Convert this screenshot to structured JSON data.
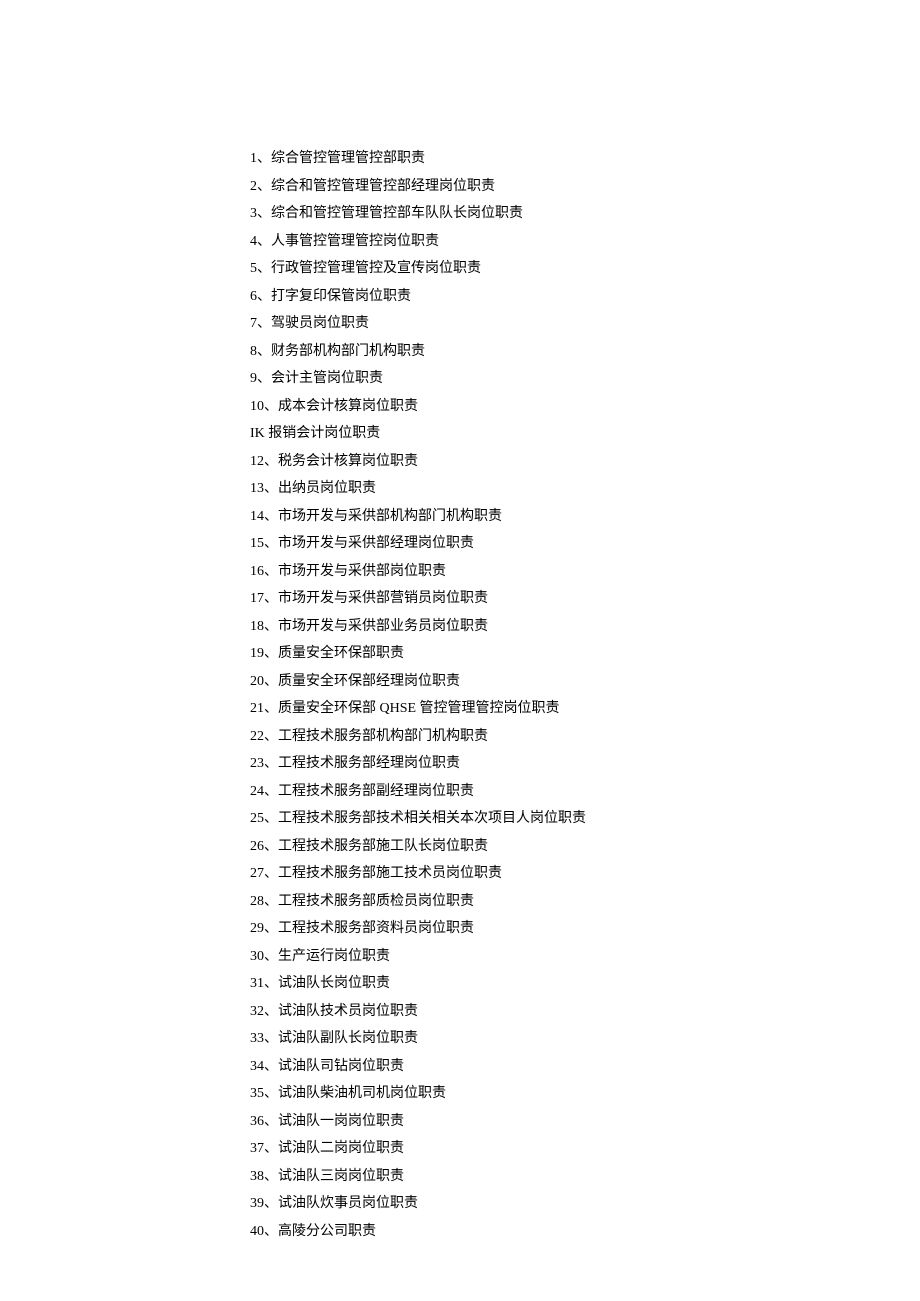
{
  "items": [
    "1、综合管控管理管控部职责",
    "2、综合和管控管理管控部经理岗位职责",
    "3、综合和管控管理管控部车队队长岗位职责",
    "4、人事管控管理管控岗位职责",
    "5、行政管控管理管控及宣传岗位职责",
    "6、打字复印保管岗位职责",
    "7、驾驶员岗位职责",
    "8、财务部机构部门机构职责",
    "9、会计主管岗位职责",
    "10、成本会计核算岗位职责",
    "IK 报销会计岗位职责",
    "12、税务会计核算岗位职责",
    "13、出纳员岗位职责",
    "14、市场开发与采供部机构部门机构职责",
    "15、市场开发与采供部经理岗位职责",
    "16、市场开发与采供部岗位职责",
    "17、市场开发与采供部营销员岗位职责",
    "18、市场开发与采供部业务员岗位职责",
    "19、质量安全环保部职责",
    "20、质量安全环保部经理岗位职责",
    "21、质量安全环保部 QHSE 管控管理管控岗位职责",
    "22、工程技术服务部机构部门机构职责",
    "23、工程技术服务部经理岗位职责",
    "24、工程技术服务部副经理岗位职责",
    "25、工程技术服务部技术相关相关本次项目人岗位职责",
    "26、工程技术服务部施工队长岗位职责",
    "27、工程技术服务部施工技术员岗位职责",
    "28、工程技术服务部质检员岗位职责",
    "29、工程技术服务部资料员岗位职责",
    "30、生产运行岗位职责",
    "31、试油队长岗位职责",
    "32、试油队技术员岗位职责",
    "33、试油队副队长岗位职责",
    "34、试油队司钻岗位职责",
    "35、试油队柴油机司机岗位职责",
    "36、试油队一岗岗位职责",
    "37、试油队二岗岗位职责",
    "38、试油队三岗岗位职责",
    "39、试油队炊事员岗位职责",
    "40、高陵分公司职责"
  ]
}
